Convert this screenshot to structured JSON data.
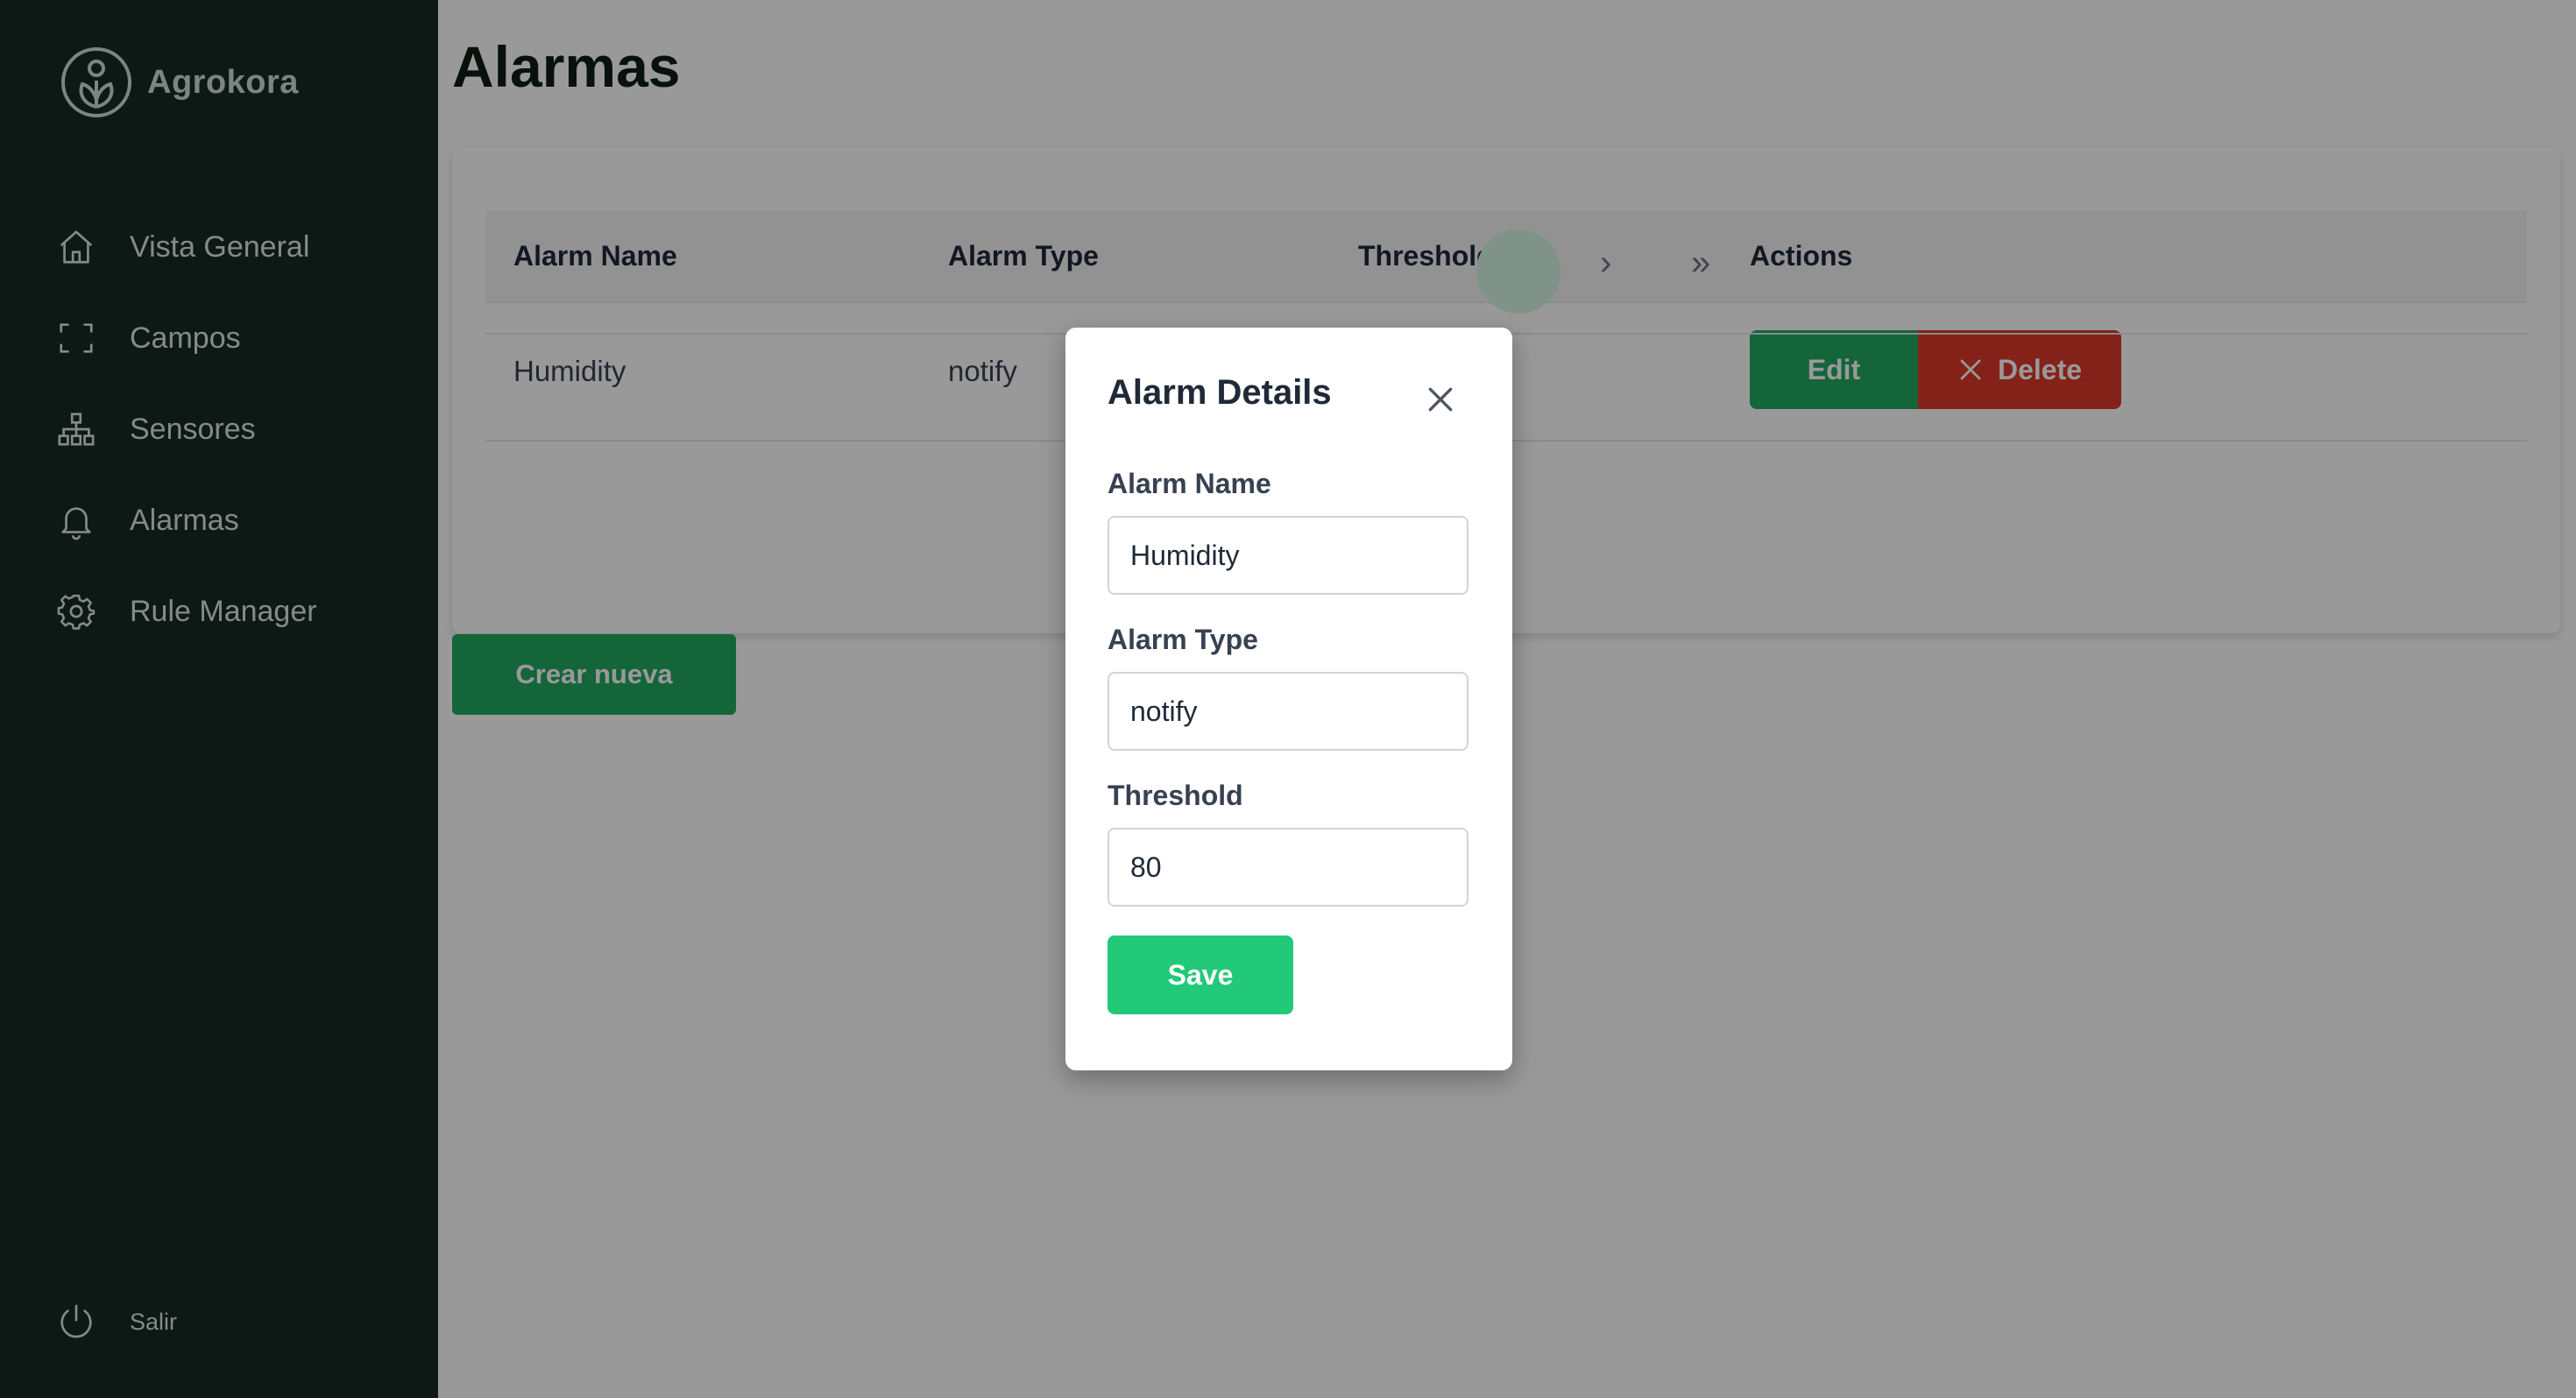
{
  "app": {
    "name": "Agrokora"
  },
  "sidebar": {
    "items": [
      {
        "label": "Vista General",
        "icon": "home-icon"
      },
      {
        "label": "Campos",
        "icon": "frame-icon"
      },
      {
        "label": "Sensores",
        "icon": "hierarchy-icon"
      },
      {
        "label": "Alarmas",
        "icon": "bell-icon"
      },
      {
        "label": "Rule Manager",
        "icon": "gear-icon"
      }
    ],
    "logout_label": "Salir"
  },
  "page": {
    "title": "Alarmas"
  },
  "table": {
    "columns": [
      "Alarm Name",
      "Alarm Type",
      "Threshold",
      "Actions"
    ],
    "rows": [
      {
        "name": "Humidity",
        "type": "notify",
        "threshold": "80"
      }
    ],
    "edit_label": "Edit",
    "delete_label": "Delete",
    "pagination": {
      "next": "›",
      "last": "»"
    }
  },
  "create_label": "Crear nueva",
  "modal": {
    "title": "Alarm Details",
    "fields": {
      "name": {
        "label": "Alarm Name",
        "value": "Humidity"
      },
      "type": {
        "label": "Alarm Type",
        "value": "notify"
      },
      "threshold": {
        "label": "Threshold",
        "value": "80"
      }
    },
    "save_label": "Save"
  },
  "colors": {
    "sidebar_bg": "#152a23",
    "primary_green": "#22a861",
    "save_green": "#22c978",
    "danger_red": "#dc3a2a"
  }
}
